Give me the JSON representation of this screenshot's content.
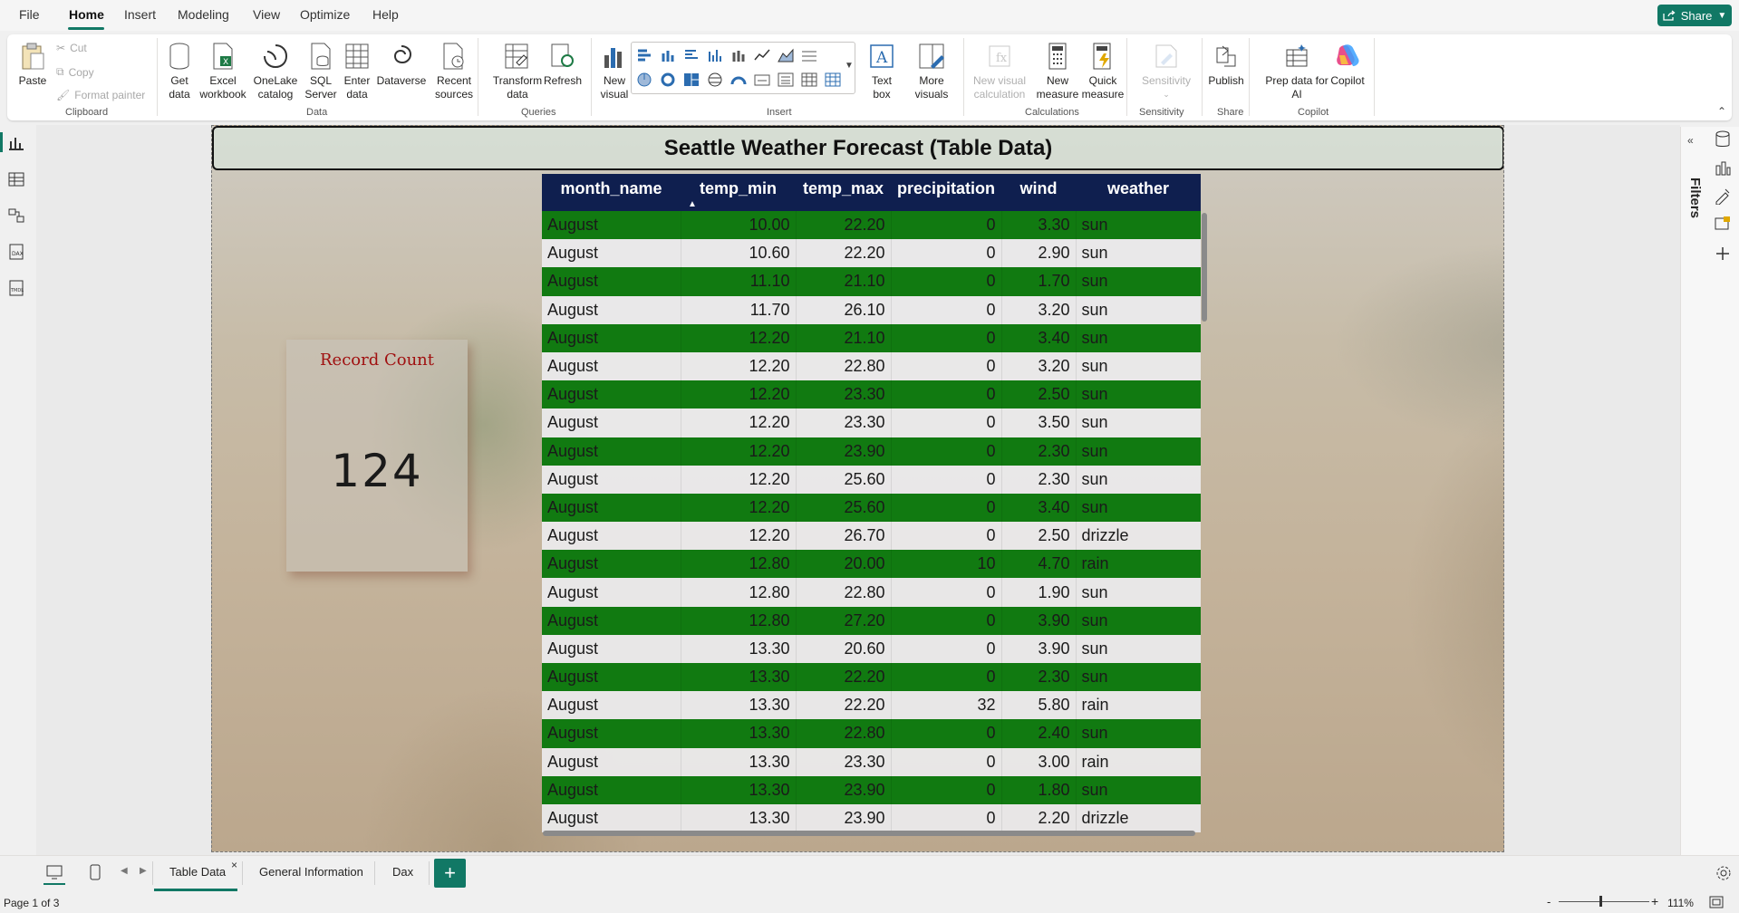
{
  "menu": {
    "items": [
      "File",
      "Home",
      "Insert",
      "Modeling",
      "View",
      "Optimize",
      "Help"
    ],
    "share_label": "Share"
  },
  "ribbon": {
    "clipboard": {
      "paste": "Paste",
      "cut": "Cut",
      "copy": "Copy",
      "format_painter": "Format painter",
      "group": "Clipboard"
    },
    "data": {
      "get_data": [
        "Get",
        "data"
      ],
      "excel": [
        "Excel",
        "workbook"
      ],
      "onelake": [
        "OneLake",
        "catalog"
      ],
      "sql": [
        "SQL",
        "Server"
      ],
      "enter_data": [
        "Enter",
        "data"
      ],
      "dataverse": [
        "Dataverse"
      ],
      "recent": [
        "Recent",
        "sources"
      ],
      "group": "Data"
    },
    "queries": {
      "transform": [
        "Transform",
        "data"
      ],
      "refresh": [
        "Refresh"
      ],
      "group": "Queries"
    },
    "insert": {
      "new_visual": [
        "New",
        "visual"
      ],
      "text_box": [
        "Text",
        "box"
      ],
      "more_visuals": [
        "More",
        "visuals"
      ],
      "group": "Insert"
    },
    "calculations": {
      "new_visual_calc": [
        "New visual",
        "calculation"
      ],
      "new_measure": [
        "New",
        "measure"
      ],
      "quick_measure": [
        "Quick",
        "measure"
      ],
      "group": "Calculations"
    },
    "sensitivity": {
      "label": [
        "Sensitivity"
      ],
      "group": "Sensitivity"
    },
    "share": {
      "publish": [
        "Publish"
      ],
      "group": "Share"
    },
    "copilot": {
      "prep_data": [
        "Prep data for",
        "AI"
      ],
      "copilot": [
        "Copilot"
      ],
      "group": "Copilot"
    }
  },
  "report": {
    "title": "Seattle Weather Forecast (Table Data)",
    "card": {
      "title": "Record Count",
      "value": "124"
    },
    "table": {
      "columns": [
        "month_name",
        "temp_min",
        "temp_max",
        "precipitation",
        "wind",
        "weather"
      ],
      "sorted_column": "temp_min",
      "rows": [
        [
          "August",
          "10.00",
          "22.20",
          "0",
          "3.30",
          "sun"
        ],
        [
          "August",
          "10.60",
          "22.20",
          "0",
          "2.90",
          "sun"
        ],
        [
          "August",
          "11.10",
          "21.10",
          "0",
          "1.70",
          "sun"
        ],
        [
          "August",
          "11.70",
          "26.10",
          "0",
          "3.20",
          "sun"
        ],
        [
          "August",
          "12.20",
          "21.10",
          "0",
          "3.40",
          "sun"
        ],
        [
          "August",
          "12.20",
          "22.80",
          "0",
          "3.20",
          "sun"
        ],
        [
          "August",
          "12.20",
          "23.30",
          "0",
          "2.50",
          "sun"
        ],
        [
          "August",
          "12.20",
          "23.30",
          "0",
          "3.50",
          "sun"
        ],
        [
          "August",
          "12.20",
          "23.90",
          "0",
          "2.30",
          "sun"
        ],
        [
          "August",
          "12.20",
          "25.60",
          "0",
          "2.30",
          "sun"
        ],
        [
          "August",
          "12.20",
          "25.60",
          "0",
          "3.40",
          "sun"
        ],
        [
          "August",
          "12.20",
          "26.70",
          "0",
          "2.50",
          "drizzle"
        ],
        [
          "August",
          "12.80",
          "20.00",
          "10",
          "4.70",
          "rain"
        ],
        [
          "August",
          "12.80",
          "22.80",
          "0",
          "1.90",
          "sun"
        ],
        [
          "August",
          "12.80",
          "27.20",
          "0",
          "3.90",
          "sun"
        ],
        [
          "August",
          "13.30",
          "20.60",
          "0",
          "3.90",
          "sun"
        ],
        [
          "August",
          "13.30",
          "22.20",
          "0",
          "2.30",
          "sun"
        ],
        [
          "August",
          "13.30",
          "22.20",
          "32",
          "5.80",
          "rain"
        ],
        [
          "August",
          "13.30",
          "22.80",
          "0",
          "2.40",
          "sun"
        ],
        [
          "August",
          "13.30",
          "23.30",
          "0",
          "3.00",
          "rain"
        ],
        [
          "August",
          "13.30",
          "23.90",
          "0",
          "1.80",
          "sun"
        ],
        [
          "August",
          "13.30",
          "23.90",
          "0",
          "2.20",
          "drizzle"
        ]
      ]
    }
  },
  "right_panel": {
    "filters_label": "Filters"
  },
  "pages": {
    "tabs": [
      "Table Data",
      "General Information",
      "Dax"
    ],
    "active": "Table Data",
    "close_glyph": "×",
    "add_glyph": "+"
  },
  "status": {
    "page_indicator": "Page 1 of 3",
    "zoom": "111%",
    "zoom_minus": "-",
    "zoom_plus": "+"
  },
  "colors": {
    "accent": "#117865",
    "header_bg": "#0f1f4f",
    "green_row": "#117a11",
    "card_title": "#a01010"
  }
}
